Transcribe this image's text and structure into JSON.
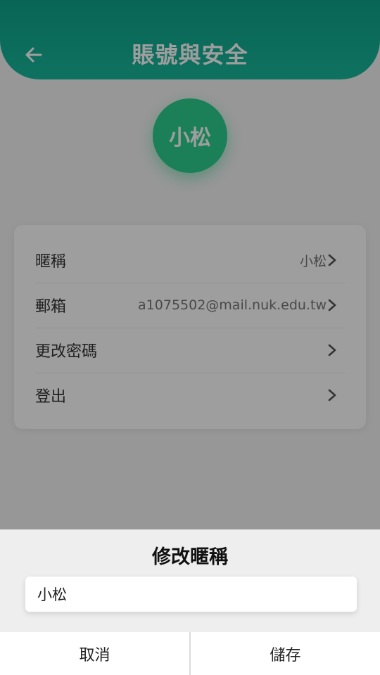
{
  "header": {
    "title": "賬號與安全",
    "back_icon": "arrow-left-icon"
  },
  "avatar": {
    "text": "小松"
  },
  "settings": {
    "rows": [
      {
        "label": "暱稱",
        "value": "小松",
        "icon": "chevron-right-icon"
      },
      {
        "label": "郵箱",
        "value": "a1075502@mail.nuk.edu.tw",
        "icon": "chevron-right-icon"
      },
      {
        "label": "更改密碼",
        "value": "",
        "icon": "chevron-right-icon"
      },
      {
        "label": "登出",
        "value": "",
        "icon": "chevron-right-icon"
      }
    ]
  },
  "dialog": {
    "title": "修改暱稱",
    "input_value": "小松",
    "cancel_label": "取消",
    "save_label": "儲存"
  },
  "colors": {
    "header": "#14ad93",
    "avatar": "#2dcf8f",
    "overlay": "rgba(0,0,0,0.38)"
  }
}
